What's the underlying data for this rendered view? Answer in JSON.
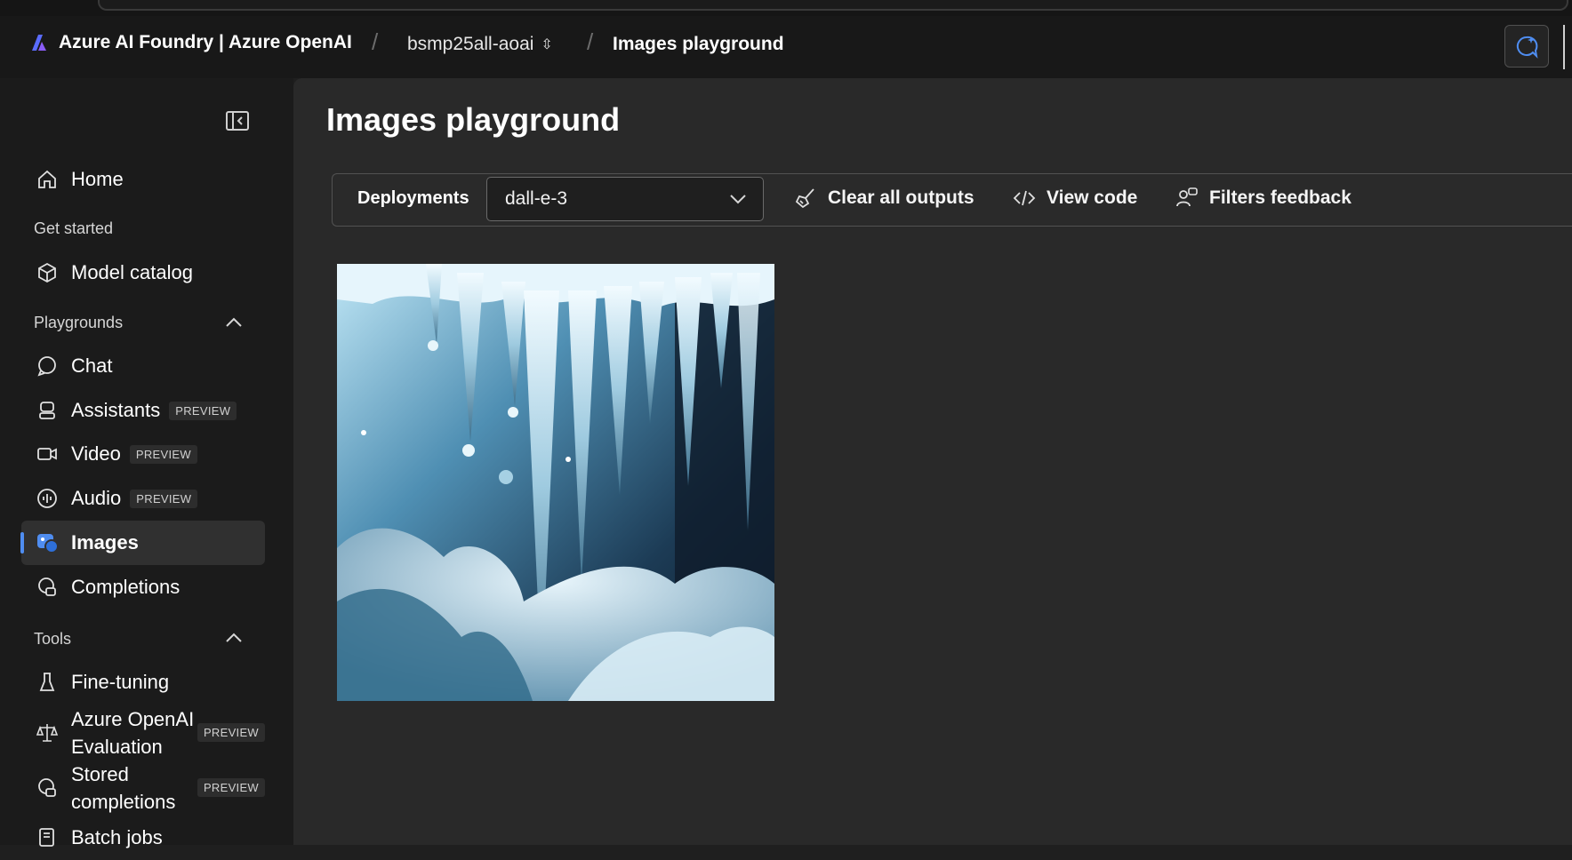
{
  "header": {
    "brand": "Azure AI Foundry | Azure OpenAI",
    "project": "bsmp25all-aoai",
    "page": "Images playground"
  },
  "sidebar": {
    "items": {
      "home": "Home",
      "model_catalog": "Model catalog",
      "chat": "Chat",
      "assistants": "Assistants",
      "video": "Video",
      "audio": "Audio",
      "images": "Images",
      "completions": "Completions",
      "fine_tuning": "Fine-tuning",
      "evaluation": "Azure OpenAI Evaluation",
      "stored_completions": "Stored completions",
      "batch_jobs": "Batch jobs"
    },
    "sections": {
      "get_started": "Get started",
      "playgrounds": "Playgrounds",
      "tools": "Tools"
    },
    "preview_badge": "PREVIEW",
    "active_item": "Images"
  },
  "main": {
    "title": "Images playground",
    "toolbar": {
      "deployments_label": "Deployments",
      "deployment_value": "dall-e-3",
      "clear_label": "Clear all outputs",
      "view_code_label": "View code",
      "filters_label": "Filters feedback"
    }
  },
  "colors": {
    "accent": "#4f8df0",
    "background": "#292929",
    "sidebar": "#1b1b1b"
  }
}
